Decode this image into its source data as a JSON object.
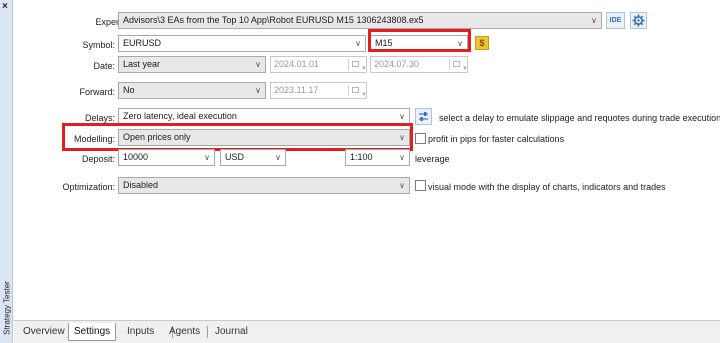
{
  "window": {
    "close_glyph": "×",
    "side_title": "Strategy Tester"
  },
  "expert": {
    "label": "Expert:",
    "value": "Advisors\\3 EAs from the Top 10 App\\Robot EURUSD M15 1306243808.ex5",
    "ide_button": "IDE",
    "settings_icon": "gear-icon"
  },
  "symbol": {
    "label": "Symbol:",
    "value": "EURUSD",
    "timeframe": "M15",
    "spec_button": "$"
  },
  "date": {
    "label": "Date:",
    "value": "Last year",
    "from": "2024.01.01",
    "to": "2024.07.30"
  },
  "forward": {
    "label": "Forward:",
    "value": "No",
    "date": "2023.11.17"
  },
  "delays": {
    "label": "Delays:",
    "value": "Zero latency, ideal execution",
    "hint": "select a delay to emulate slippage and requotes during trade execution",
    "icon": "sliders-icon"
  },
  "modelling": {
    "label": "Modelling:",
    "value": "Open prices only",
    "checkbox_label": "profit in pips for faster calculations"
  },
  "deposit": {
    "label": "Deposit:",
    "amount": "10000",
    "currency": "USD",
    "leverage_value": "1:100",
    "leverage_label": "leverage"
  },
  "optimization": {
    "label": "Optimization:",
    "value": "Disabled",
    "checkbox_label": "visual mode with the display of charts, indicators and trades"
  },
  "tabs": [
    {
      "label": "Overview",
      "active": false
    },
    {
      "label": "Settings",
      "active": true
    },
    {
      "label": "Inputs",
      "active": false
    },
    {
      "label": "Agents",
      "active": false
    },
    {
      "label": "Journal",
      "active": false
    }
  ],
  "colors": {
    "highlight": "#e02020",
    "accent": "#3a6fb5",
    "sidebar": "#dbe6f3"
  }
}
